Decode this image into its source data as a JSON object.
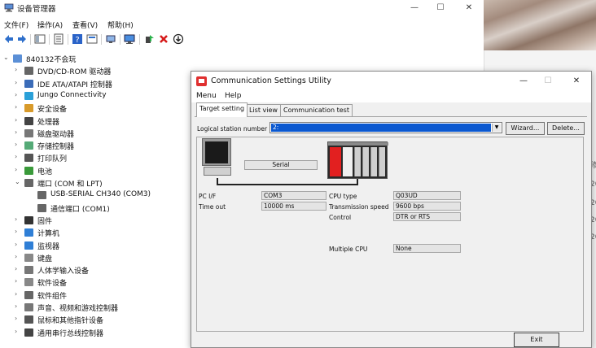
{
  "device_manager": {
    "title": "设备管理器",
    "window_controls": [
      "—",
      "☐",
      "✕"
    ],
    "menu": [
      "文件(F)",
      "操作(A)",
      "查看(V)",
      "帮助(H)"
    ],
    "tree": [
      {
        "label": "840132不会玩",
        "chevron": "⌄",
        "icon": "computer-icon",
        "level": 0
      },
      {
        "label": "DVD/CD-ROM 驱动器",
        "chevron": "›",
        "icon": "dvd-drive-icon",
        "level": 1
      },
      {
        "label": "IDE ATA/ATAPI 控制器",
        "chevron": "›",
        "icon": "ide-controller-icon",
        "level": 1
      },
      {
        "label": "Jungo Connectivity",
        "chevron": "›",
        "icon": "jungo-icon",
        "level": 1
      },
      {
        "label": "安全设备",
        "chevron": "›",
        "icon": "security-device-icon",
        "level": 1
      },
      {
        "label": "处理器",
        "chevron": "›",
        "icon": "processor-icon",
        "level": 1
      },
      {
        "label": "磁盘驱动器",
        "chevron": "›",
        "icon": "disk-drive-icon",
        "level": 1
      },
      {
        "label": "存储控制器",
        "chevron": "›",
        "icon": "storage-controller-icon",
        "level": 1
      },
      {
        "label": "打印队列",
        "chevron": "›",
        "icon": "printer-icon",
        "level": 1
      },
      {
        "label": "电池",
        "chevron": "›",
        "icon": "battery-icon",
        "level": 1
      },
      {
        "label": "端口 (COM 和 LPT)",
        "chevron": "⌄",
        "icon": "port-icon",
        "level": 1
      },
      {
        "label": "USB-SERIAL CH340 (COM3)",
        "chevron": "",
        "icon": "port-icon",
        "level": 2
      },
      {
        "label": "通信端口 (COM1)",
        "chevron": "",
        "icon": "port-icon",
        "level": 2
      },
      {
        "label": "固件",
        "chevron": "›",
        "icon": "firmware-icon",
        "level": 1
      },
      {
        "label": "计算机",
        "chevron": "›",
        "icon": "computer-monitor-icon",
        "level": 1
      },
      {
        "label": "监视器",
        "chevron": "›",
        "icon": "monitor-icon",
        "level": 1
      },
      {
        "label": "键盘",
        "chevron": "›",
        "icon": "keyboard-icon",
        "level": 1
      },
      {
        "label": "人体学输入设备",
        "chevron": "›",
        "icon": "hid-icon",
        "level": 1
      },
      {
        "label": "软件设备",
        "chevron": "›",
        "icon": "software-device-icon",
        "level": 1
      },
      {
        "label": "软件组件",
        "chevron": "›",
        "icon": "software-component-icon",
        "level": 1
      },
      {
        "label": "声音、视频和游戏控制器",
        "chevron": "›",
        "icon": "sound-icon",
        "level": 1
      },
      {
        "label": "鼠标和其他指针设备",
        "chevron": "›",
        "icon": "mouse-icon",
        "level": 1
      },
      {
        "label": "通用串行总线控制器",
        "chevron": "›",
        "icon": "usb-icon",
        "level": 1
      }
    ]
  },
  "background_window": {
    "cells": [
      "修",
      "20",
      "20",
      "20",
      "20"
    ]
  },
  "comm_utility": {
    "title": "Communication Settings Utility",
    "window_controls": [
      "—",
      "☐",
      "✕"
    ],
    "menu": [
      "Menu",
      "Help"
    ],
    "tabs": [
      "Target setting",
      "List view",
      "Communication test"
    ],
    "logical_station_label": "Logical station number",
    "logical_station_value": "2:",
    "wizard_button": "Wizard...",
    "delete_button": "Delete...",
    "serial_label": "Serial",
    "left_fields": [
      {
        "label": "PC I/F",
        "value": "COM3"
      },
      {
        "label": "Time out",
        "value": "10000 ms"
      }
    ],
    "right_fields": [
      {
        "label": "CPU type",
        "value": "Q03UD"
      },
      {
        "label": "Transmission speed",
        "value": "9600 bps"
      },
      {
        "label": "Control",
        "value": "DTR or RTS"
      },
      {
        "label": "Multiple CPU",
        "value": "None"
      }
    ],
    "exit_button": "Exit"
  }
}
